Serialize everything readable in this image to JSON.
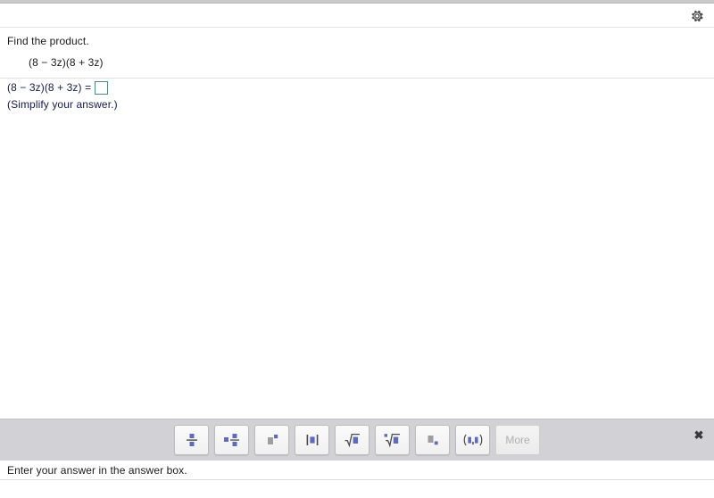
{
  "header": {
    "gear_icon": "gear-icon"
  },
  "problem": {
    "prompt": "Find the product.",
    "expression": "(8 − 3z)(8 + 3z)"
  },
  "answer": {
    "equation_label": "(8 − 3z)(8 + 3z) =",
    "input_value": "",
    "input_placeholder": "",
    "hint": "(Simplify your answer.)"
  },
  "palette": {
    "buttons": [
      {
        "name": "fraction-button",
        "icon": "fraction-icon",
        "label": "Fraction",
        "enabled": true
      },
      {
        "name": "mixed-number-button",
        "icon": "mixed-number-icon",
        "label": "Mixed number",
        "enabled": true
      },
      {
        "name": "exponent-button",
        "icon": "exponent-icon",
        "label": "Exponent",
        "enabled": true
      },
      {
        "name": "absolute-value-button",
        "icon": "absolute-value-icon",
        "label": "Absolute value",
        "enabled": true
      },
      {
        "name": "square-root-button",
        "icon": "square-root-icon",
        "label": "Square root",
        "enabled": true
      },
      {
        "name": "nth-root-button",
        "icon": "nth-root-icon",
        "label": "Nth root",
        "enabled": true
      },
      {
        "name": "subscript-button",
        "icon": "subscript-icon",
        "label": "Subscript",
        "enabled": true
      },
      {
        "name": "interval-button",
        "icon": "interval-icon",
        "label": "Interval notation",
        "enabled": true
      }
    ],
    "more_label": "More",
    "more_enabled": false,
    "close_label": "✖"
  },
  "status": {
    "message": "Enter your answer in the answer box."
  },
  "colors": {
    "answer_text": "#151b4d",
    "answer_box_border": "#4f8a8b",
    "palette_background": "#d2d2d6",
    "icon_blue": "#5c6bc0",
    "icon_gray": "#9e9e9e"
  }
}
